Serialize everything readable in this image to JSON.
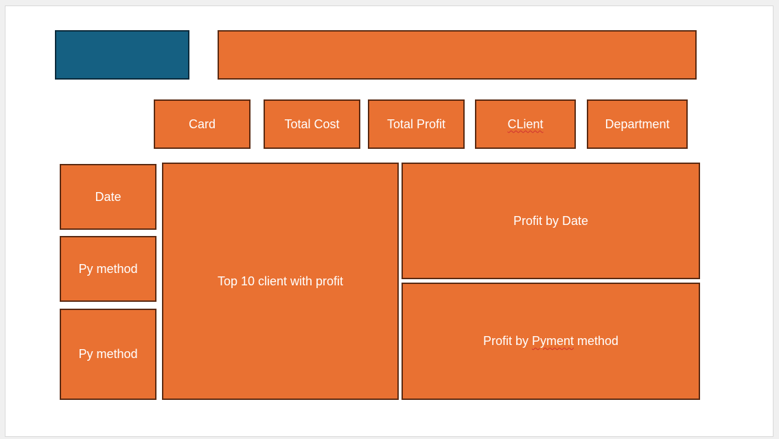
{
  "colors": {
    "accent_orange": "#e97132",
    "accent_blue": "#156082",
    "border": "#5a2a12"
  },
  "header": {
    "logo_box": "",
    "title_box": ""
  },
  "kpi_cards": {
    "card": "Card",
    "total_cost": "Total Cost",
    "total_profit": "Total Profit",
    "client": "CLient",
    "department": "Department"
  },
  "filters": {
    "date": "Date",
    "py_method_1": "Py method",
    "py_method_2": "Py method"
  },
  "visuals": {
    "top10_clients": "Top 10 client with profit",
    "profit_by_date": "Profit by Date",
    "profit_by_payment_prefix": "Profit by ",
    "profit_by_payment_word": "Pyment",
    "profit_by_payment_suffix": " method"
  }
}
